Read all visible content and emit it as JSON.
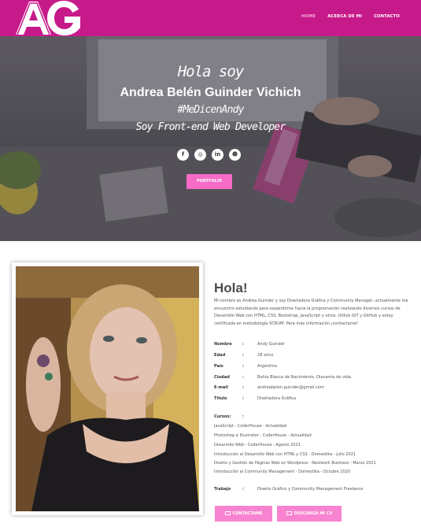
{
  "navbar": {
    "logo_text": "AG",
    "links": [
      {
        "label": "HOME",
        "active": true
      },
      {
        "label": "ACERCA DE MI",
        "active": false
      },
      {
        "label": "CONTACTO",
        "active": false
      }
    ],
    "bg_color": "#c71a8a"
  },
  "hero": {
    "greeting": "Hola soy",
    "name": "Andrea Belén Guinder Vichich",
    "hashtag": "#MeDicenAndy",
    "role": "Soy Front-end Web Developer",
    "socials": [
      {
        "icon": "facebook-icon",
        "glyph": "f"
      },
      {
        "icon": "instagram-icon",
        "glyph": "◎"
      },
      {
        "icon": "linkedin-icon",
        "glyph": "in"
      },
      {
        "icon": "github-icon",
        "glyph": "☻"
      }
    ],
    "portfolio_button": "PORTFOLIO"
  },
  "about": {
    "title": "Hola!",
    "paragraph": "Mi nombre es Andrea Guinder y soy Diseñadora Gráfica y Community Manager, actualmente me encuentro estudiando para expandirme hacia la programación realizando diversos cursos de Desarrollo Web con HTML, CSS, Bootstrap, JavaScript y otros. Utilizo GIT y GitHub y estoy certificada en metodología SCRUM. Para más información ¡contactame!",
    "info": [
      {
        "key": "Nombre",
        "value": "Andy Guinder"
      },
      {
        "key": "Edad",
        "value": "28 años"
      },
      {
        "key": "País",
        "value": "Argentina"
      },
      {
        "key": "Ciudad",
        "value": "Bahía Blanca de Nacimiento, Olavarría de vida."
      },
      {
        "key": "E-mail",
        "value": "andreabelen.guinder@gmail.com"
      },
      {
        "key": "Título",
        "value": "Diseñadora Gráfica"
      }
    ],
    "courses_label": "Cursos:",
    "courses": [
      "JavaScript - CoderHouse - Actualidad",
      "Photoshop e Illustrator - CoderHouse - Actualidad",
      "Desarrollo Web - CoderHouse - Agosto 2021",
      "Introducción al Desarrollo Web con HTML y CSS - Domestika - Julio 2021",
      "Diseño y Gestión de Páginas Web en Wordpress - Nestwork Business - Marzo 2021",
      "Introducción al Community Management - Domestika - Octubre 2020"
    ],
    "work_label": "Trabajo",
    "work_value": "Diseño Gráfico y Community Management Freelance",
    "separator": ":",
    "contact_button": "CONTACTAME",
    "cv_button": "DESCARGÁ MI CV"
  }
}
